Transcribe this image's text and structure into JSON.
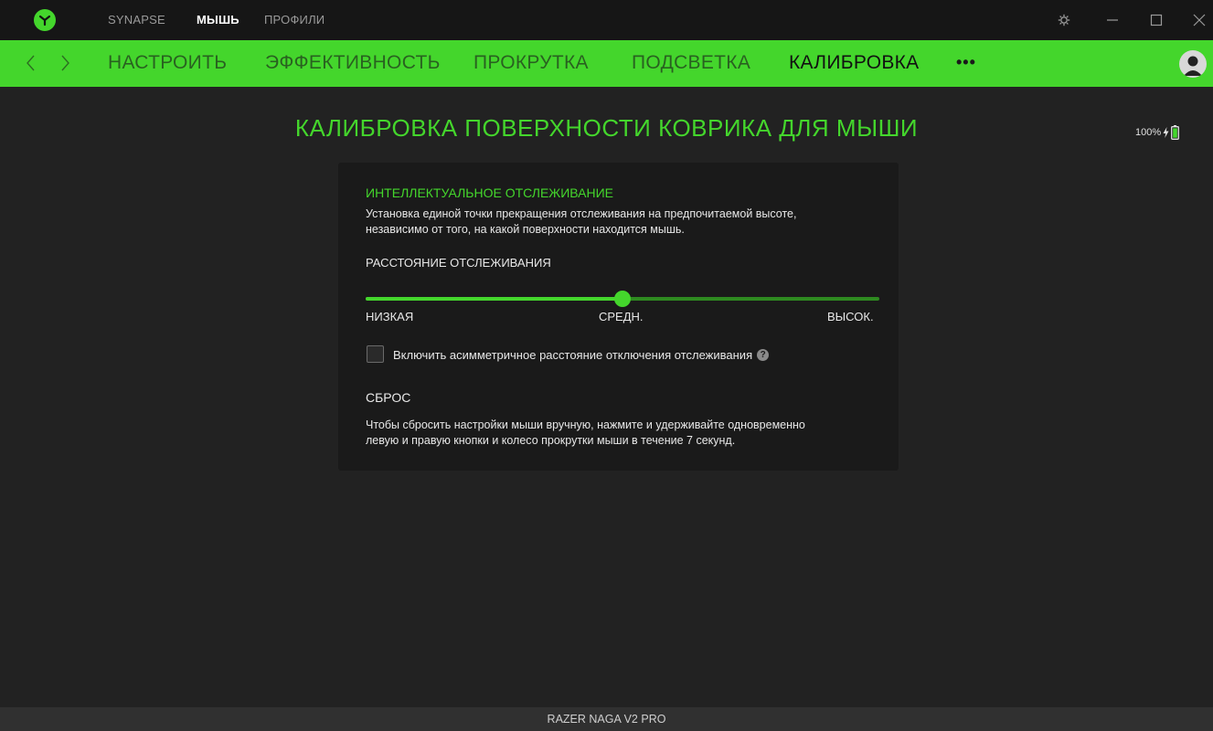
{
  "top_tabs": [
    "SYNAPSE",
    "МЫШЬ",
    "ПРОФИЛИ"
  ],
  "nav": {
    "tabs": [
      "НАСТРОИТЬ",
      "ЭФФЕКТИВНОСТЬ",
      "ПРОКРУТКА",
      "ПОДСВЕТКА",
      "КАЛИБРОВКА"
    ],
    "active_tab": "КАЛИБРОВКА",
    "more_label": "•••"
  },
  "page": {
    "title": "КАЛИБРОВКА ПОВЕРХНОСТИ КОВРИКА ДЛЯ МЫШИ",
    "battery_percent": "100%"
  },
  "tracking": {
    "title": "ИНТЕЛЛЕКТУАЛЬНОЕ ОТСЛЕЖИВАНИЕ",
    "desc_line1": "Установка единой точки прекращения отслеживания на предпочитаемой высоте,",
    "desc_line2": "независимо от того, на какой поверхности находится мышь.",
    "distance_label": "РАССТОЯНИЕ ОТСЛЕЖИВАНИЯ",
    "slider": {
      "low": "НИЗКАЯ",
      "mid": "СРЕДН.",
      "high": "ВЫСОК.",
      "value_fraction": 0.5
    },
    "asymmetric_label": "Включить асимметричное расстояние отключения отслеживания",
    "asymmetric_checked": false
  },
  "reset": {
    "title": "СБРОС",
    "desc_line1": "Чтобы сбросить настройки мыши вручную, нажмите и удерживайте одновременно",
    "desc_line2": "левую и правую кнопки и колесо прокрутки мыши в течение 7 секунд."
  },
  "footer": {
    "device_name": "RAZER NAGA V2 PRO"
  },
  "colors": {
    "accent": "#44d62c",
    "background": "#222222",
    "card": "#1a1a1a",
    "titlebar": "#161616"
  }
}
